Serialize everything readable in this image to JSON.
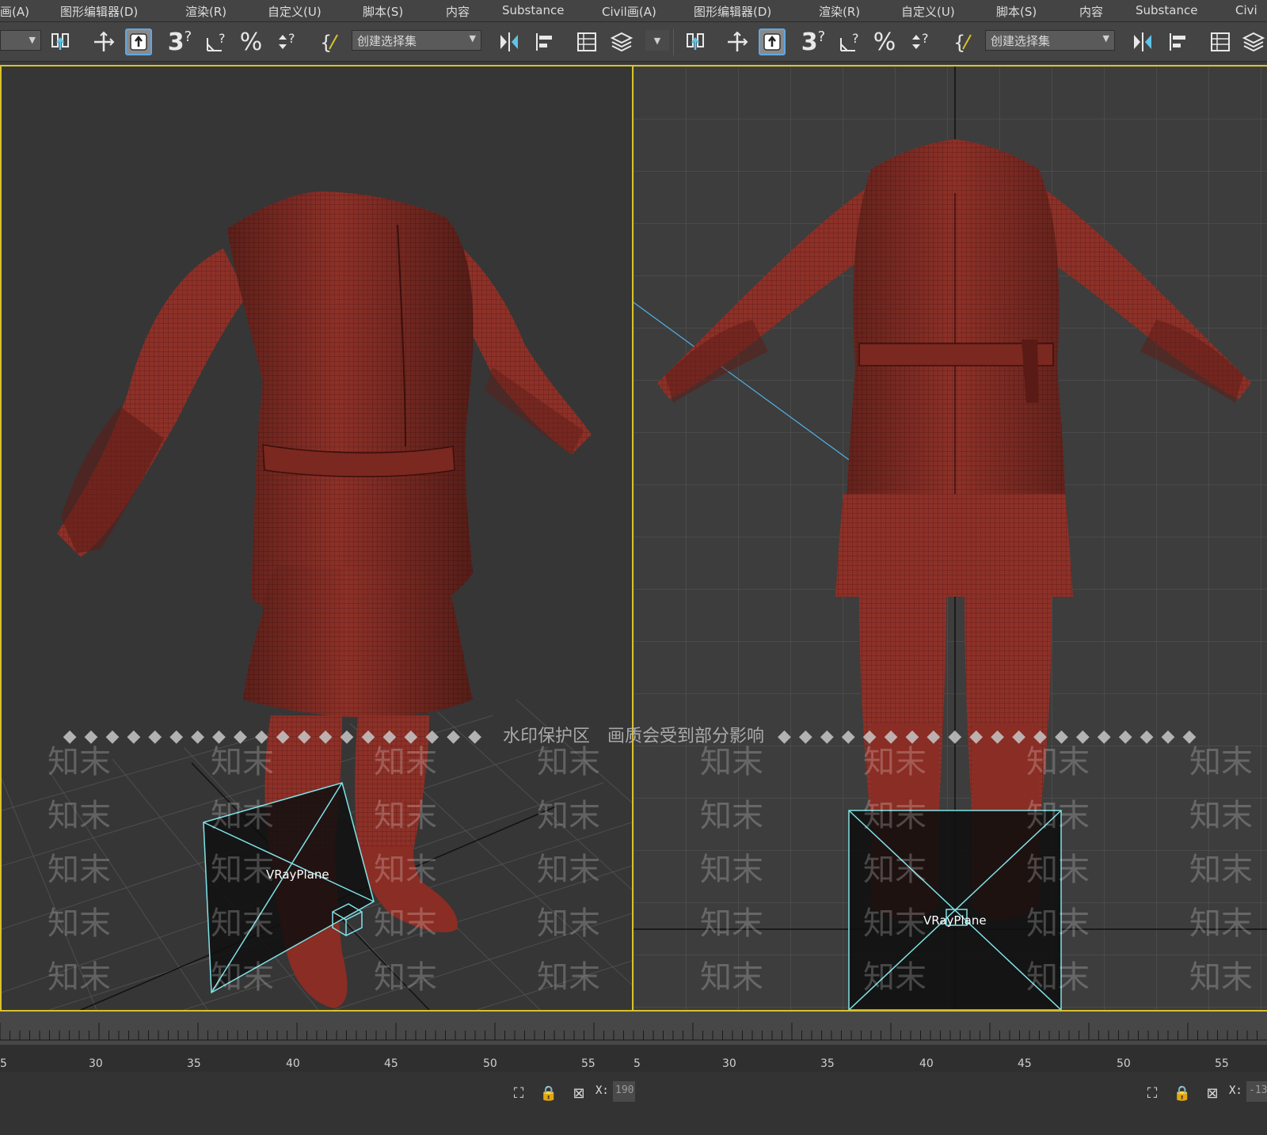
{
  "menus": {
    "left": [
      "画(A)",
      "图形编辑器(D)",
      "渲染(R)",
      "自定义(U)",
      "脚本(S)",
      "内容",
      "Substance",
      "Civil画(A)"
    ],
    "right": [
      "图形编辑器(D)",
      "渲染(R)",
      "自定义(U)",
      "脚本(S)",
      "内容",
      "Substance",
      "Civi"
    ]
  },
  "toolbar": {
    "selection_set_placeholder": "创建选择集",
    "snap_label": "3"
  },
  "viewports": {
    "left": {
      "object_label": "VRayPlane"
    },
    "right": {
      "object_label": "VRayPlane"
    }
  },
  "watermark": {
    "banner": "水印保护区　画质会受到部分影响",
    "tile": "知末",
    "small_tile": "知末"
  },
  "timeline": {
    "left_ticks": [
      "5",
      "30",
      "35",
      "40",
      "45",
      "50",
      "55"
    ],
    "right_ticks": [
      "5",
      "30",
      "35",
      "40",
      "45",
      "50",
      "55"
    ]
  },
  "status": {
    "x_label": "X:",
    "left_x_value": "190",
    "right_x_value": "-13"
  },
  "colors": {
    "viewport_border": "#d8c22a",
    "cloth": "#8a2f26",
    "active_button": "#5fa7e8",
    "vrayplane_line": "#7fe3e8"
  }
}
